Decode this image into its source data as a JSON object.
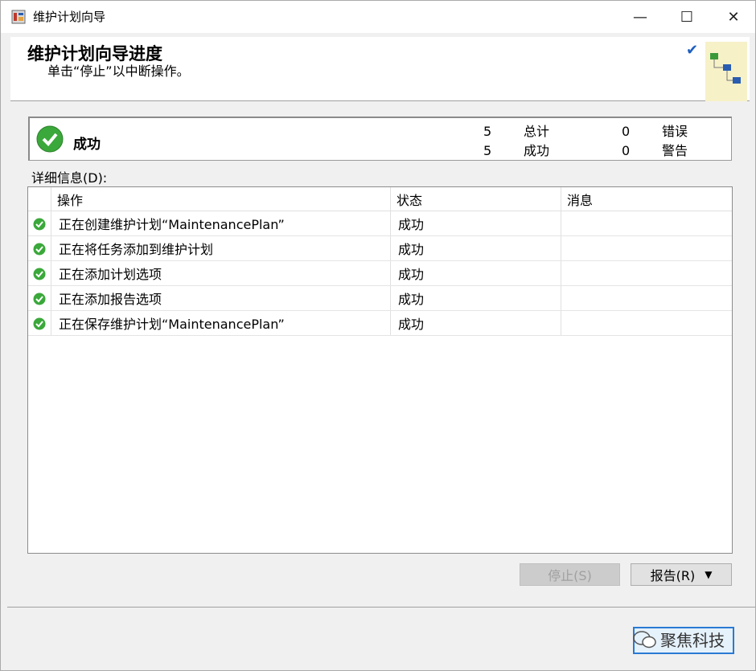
{
  "window": {
    "title": "维护计划向导",
    "minimize_glyph": "—",
    "maximize_glyph": "☐",
    "close_glyph": "✕"
  },
  "header": {
    "title": "维护计划向导进度",
    "subtitle": "单击“停止”以中断操作。"
  },
  "summary": {
    "status": "成功",
    "total_count": "5",
    "total_label": "总计",
    "success_count": "5",
    "success_label": "成功",
    "error_count": "0",
    "error_label": "错误",
    "warning_count": "0",
    "warning_label": "警告"
  },
  "details": {
    "label": "详细信息(D):",
    "columns": [
      "操作",
      "状态",
      "消息"
    ],
    "rows": [
      {
        "action": "正在创建维护计划“MaintenancePlan”",
        "status": "成功",
        "message": ""
      },
      {
        "action": "正在将任务添加到维护计划",
        "status": "成功",
        "message": ""
      },
      {
        "action": "正在添加计划选项",
        "status": "成功",
        "message": ""
      },
      {
        "action": "正在添加报告选项",
        "status": "成功",
        "message": ""
      },
      {
        "action": "正在保存维护计划“MaintenancePlan”",
        "status": "成功",
        "message": ""
      }
    ]
  },
  "buttons": {
    "stop": "停止(S)",
    "report": "报告(R)",
    "report_arrow": "▼"
  },
  "watermark": "聚焦科技",
  "colors": {
    "success": "#3aa83a",
    "focus_border": "#2a7ad2",
    "accent_check": "#1f5fbf"
  },
  "icons": [
    "app-icon",
    "checkmark-icon",
    "wizard-image",
    "success-icon",
    "wechat-icon"
  ]
}
